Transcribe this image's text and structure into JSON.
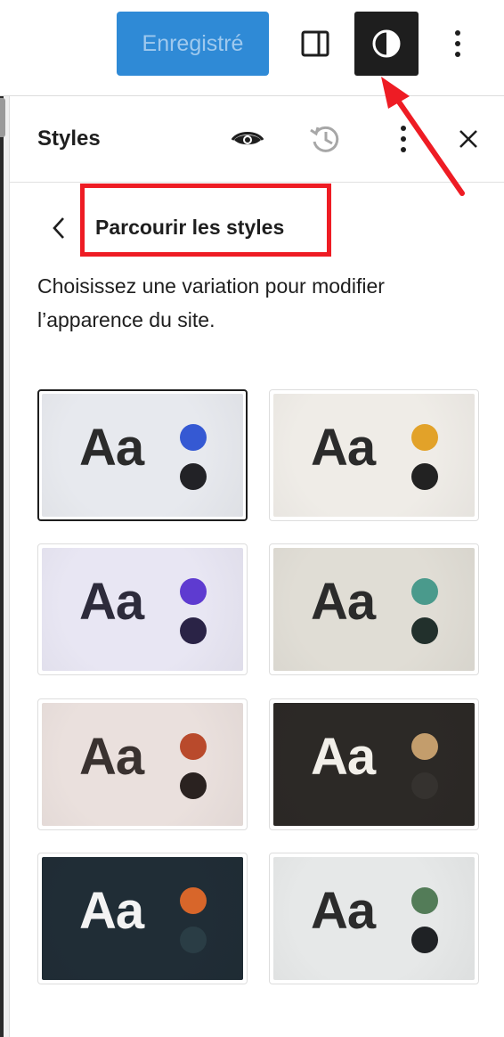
{
  "toolbar": {
    "save_label": "Enregistré",
    "icons": [
      "sidebar-toggle-icon",
      "styles-contrast-icon",
      "more-options-icon"
    ],
    "save_color": "#2f8ad6"
  },
  "panel": {
    "title": "Styles",
    "header_icons": [
      "eye-icon",
      "revisions-history-icon",
      "more-vertical-icon",
      "close-icon"
    ],
    "nav_title": "Parcourir les styles",
    "description": "Choisissez une variation pour modifier l’apparence du site."
  },
  "variations": [
    {
      "sample": "Aa",
      "bg": "#e7e9ee",
      "text_color": "#2b2b2b",
      "accent": "#3559d3",
      "secondary": "#222226",
      "selected": true
    },
    {
      "sample": "Aa",
      "bg": "#efece7",
      "text_color": "#2b2b2b",
      "accent": "#e2a229",
      "secondary": "#222222",
      "selected": false
    },
    {
      "sample": "Aa",
      "bg": "#e8e6f3",
      "text_color": "#2d2b3b",
      "accent": "#5e3bd0",
      "secondary": "#2a2346",
      "selected": false
    },
    {
      "sample": "Aa",
      "bg": "#e0ddd5",
      "text_color": "#2b2b2b",
      "accent": "#4a9a8c",
      "secondary": "#22302c",
      "selected": false
    },
    {
      "sample": "Aa",
      "bg": "#eae0dd",
      "text_color": "#3a3230",
      "accent": "#b94a2c",
      "secondary": "#2a2220",
      "selected": false
    },
    {
      "sample": "Aa",
      "bg": "#2c2926",
      "text_color": "#f2efe9",
      "accent": "#c39d6c",
      "secondary": "#35322f",
      "selected": false
    },
    {
      "sample": "Aa",
      "bg": "#202d36",
      "text_color": "#f3f3f3",
      "accent": "#d8662a",
      "secondary": "#2a3d45",
      "selected": false
    },
    {
      "sample": "Aa",
      "bg": "#e6e8e8",
      "text_color": "#2b2b2b",
      "accent": "#537c58",
      "secondary": "#1f2225",
      "selected": false
    }
  ],
  "annotation_color": "#ee1c24"
}
